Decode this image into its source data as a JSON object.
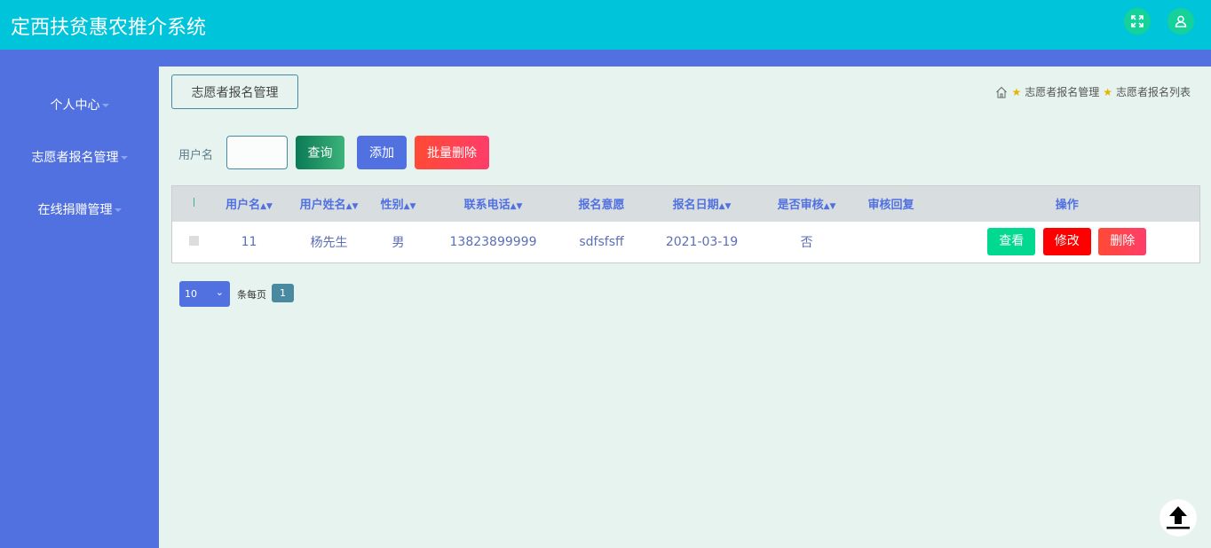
{
  "app_title": "定西扶贫惠农推介系统",
  "sidebar": {
    "items": [
      {
        "label": "个人中心"
      },
      {
        "label": "志愿者报名管理"
      },
      {
        "label": "在线捐赠管理"
      }
    ]
  },
  "page_title": "志愿者报名管理",
  "breadcrumb": [
    "志愿者报名管理",
    "志愿者报名列表"
  ],
  "search": {
    "label": "用户名",
    "value": "",
    "query_label": "查询",
    "add_label": "添加",
    "batch_delete_label": "批量删除"
  },
  "table": {
    "columns": [
      "用户名",
      "用户姓名",
      "性别",
      "联系电话",
      "报名意愿",
      "报名日期",
      "是否审核",
      "审核回复",
      "操作"
    ],
    "rows": [
      {
        "username": "11",
        "name": "杨先生",
        "gender": "男",
        "phone": "13823899999",
        "intent": "sdfsfsff",
        "date": "2021-03-19",
        "reviewed": "否",
        "reply": ""
      }
    ],
    "actions": {
      "view": "查看",
      "edit": "修改",
      "delete": "删除"
    }
  },
  "pagination": {
    "page_size": "10",
    "per_page_label": "条每页",
    "current_page": "1"
  },
  "colors": {
    "header": "#00c4d9",
    "sidebar": "#5171e0",
    "content": "#e6f3ee"
  }
}
